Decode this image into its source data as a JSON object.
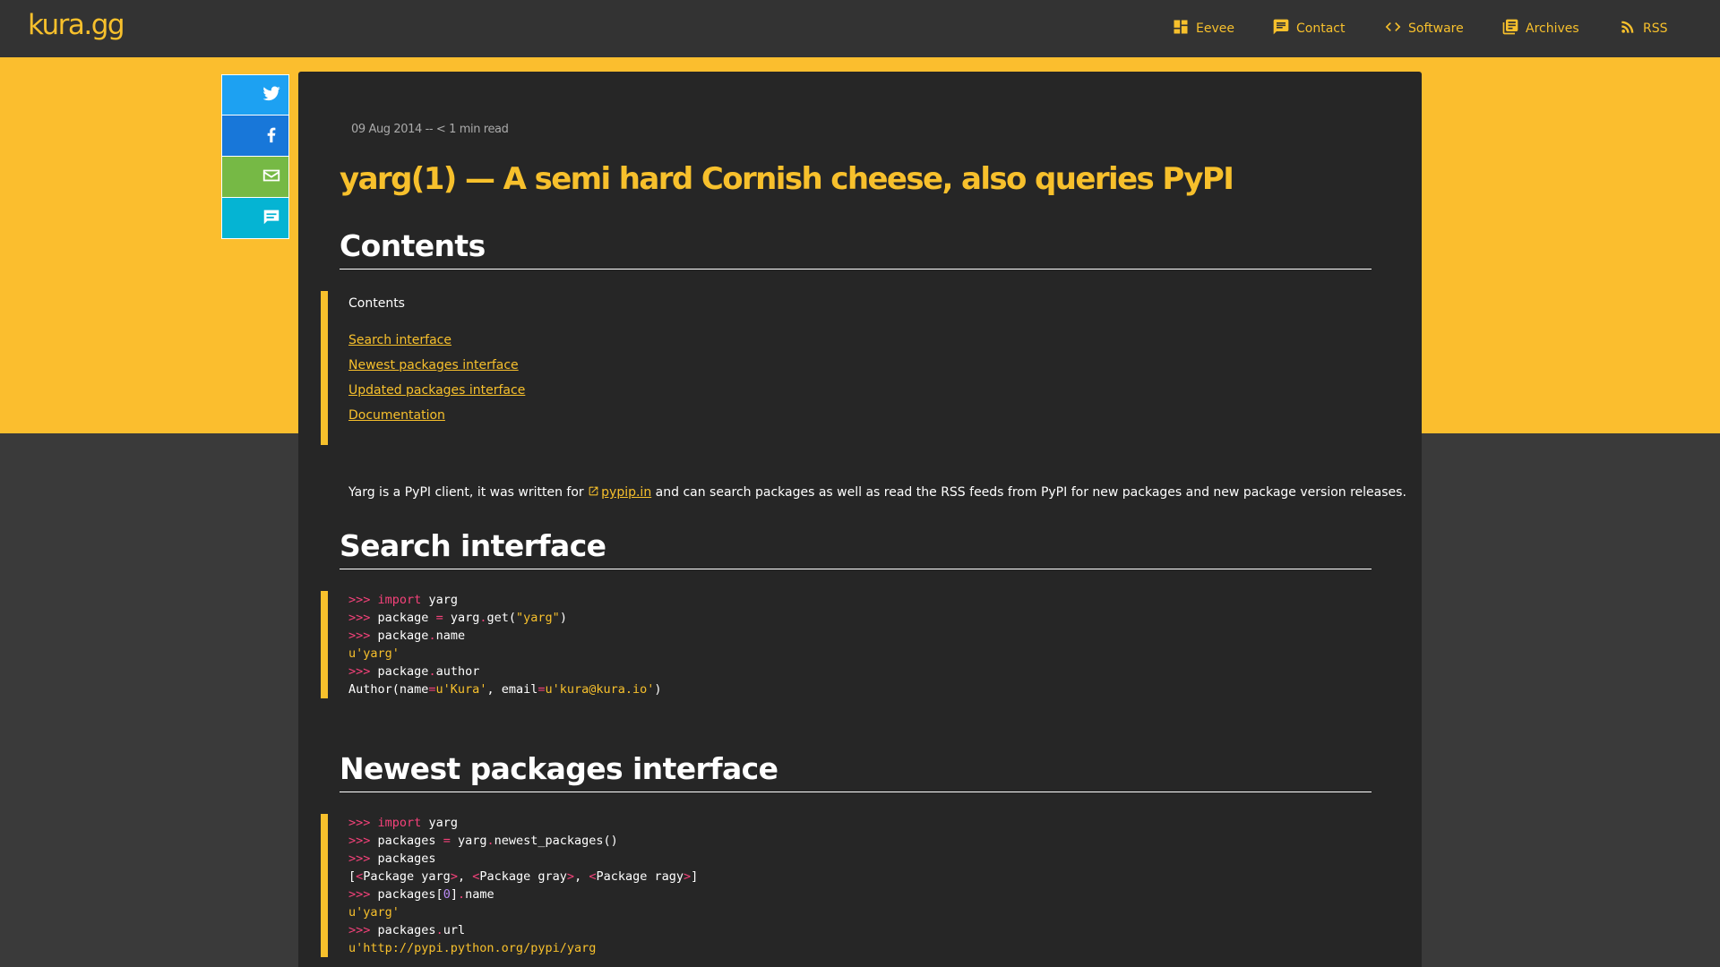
{
  "brand": "kura.gg",
  "nav": [
    {
      "label": "Eevee",
      "icon": "dashboard-icon"
    },
    {
      "label": "Contact",
      "icon": "chat-icon"
    },
    {
      "label": "Software",
      "icon": "code-icon"
    },
    {
      "label": "Archives",
      "icon": "book-icon"
    },
    {
      "label": "RSS",
      "icon": "rss-icon"
    }
  ],
  "share": [
    {
      "icon": "twitter-icon",
      "color": "#1da1f2"
    },
    {
      "icon": "facebook-icon",
      "color": "#1877d9"
    },
    {
      "icon": "email-icon",
      "color": "#76b945"
    },
    {
      "icon": "comment-icon",
      "color": "#05b4d3"
    }
  ],
  "article": {
    "meta": "09 Aug 2014 -- < 1 min read",
    "title": "yarg(1) — A semi hard Cornish cheese, also queries PyPI",
    "contents_heading": "Contents",
    "toc_title": "Contents",
    "toc": [
      "Search interface",
      "Newest packages interface",
      "Updated packages interface",
      "Documentation"
    ],
    "intro_before": "Yarg is a PyPI client, it was written for ",
    "intro_link": "pypip.in",
    "intro_after": " and can search packages as well as read the RSS feeds from PyPI for new packages and new package version releases.",
    "search_heading": "Search interface",
    "newest_heading": "Newest packages interface"
  },
  "code": {
    "prompt": ">>>",
    "kw_import": "import",
    "s1_l1": "yarg",
    "s1_l2a": "package",
    "s1_eq": "=",
    "s1_l2b": "yarg",
    "s1_dot": ".",
    "s1_l2c": "get(",
    "s1_l2d": "\"yarg\"",
    "s1_l2e": ")",
    "s1_l3a": "package",
    "s1_l3b": "name",
    "s1_l4": "u'yarg'",
    "s1_l5a": "package",
    "s1_l5b": "author",
    "s1_l6a": "Author(name",
    "s1_l6b": "u'Kura'",
    "s1_l6c": ", email",
    "s1_l6d": "u'kura@kura.io'",
    "s1_l6e": ")",
    "s2_l2a": "packages",
    "s2_l2b": "yarg",
    "s2_l2c": "newest_packages()",
    "s2_l3": "packages",
    "s2_l4a": "[",
    "s2_lt": "<",
    "s2_gt": ">",
    "s2_pkg1": "Package yarg",
    "s2_sep": ", ",
    "s2_pkg2": "Package gray",
    "s2_pkg3": "Package ragy",
    "s2_l4z": "]",
    "s2_l5a": "packages[",
    "s2_l5n": "0",
    "s2_l5b": "]",
    "s2_l5c": "name",
    "s2_l6": "u'yarg'",
    "s2_l7a": "packages",
    "s2_l7b": "url",
    "s2_l8": "u'http://pypi.python.org/pypi/yarg"
  }
}
